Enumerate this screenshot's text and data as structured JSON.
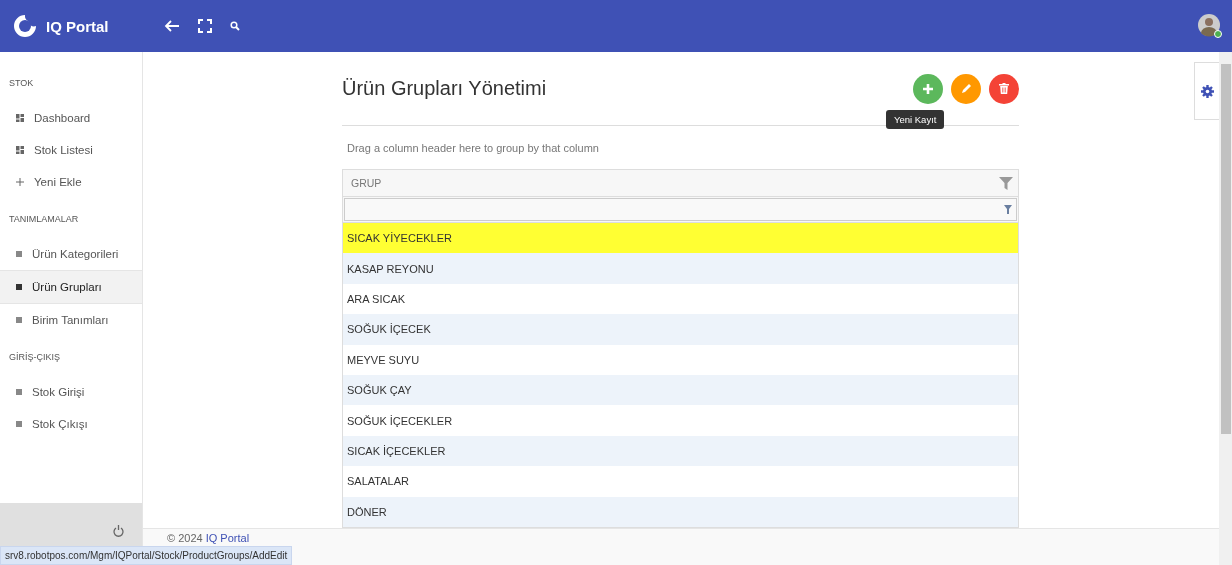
{
  "header": {
    "app_name": "IQ Portal"
  },
  "sidebar": {
    "sections": [
      {
        "title": "STOK",
        "items": [
          {
            "label": "Dashboard",
            "kind": "grid",
            "selected": false
          },
          {
            "label": "Stok Listesi",
            "kind": "grid",
            "selected": false
          },
          {
            "label": "Yeni Ekle",
            "kind": "plus",
            "selected": false
          }
        ]
      },
      {
        "title": "TANIMLAMALAR",
        "items": [
          {
            "label": "Ürün Kategorileri",
            "kind": "square",
            "selected": false
          },
          {
            "label": "Ürün Grupları",
            "kind": "square",
            "selected": true
          },
          {
            "label": "Birim Tanımları",
            "kind": "square",
            "selected": false
          }
        ]
      },
      {
        "title": "GİRİŞ-ÇIKIŞ",
        "items": [
          {
            "label": "Stok Girişi",
            "kind": "square",
            "selected": false
          },
          {
            "label": "Stok Çıkışı",
            "kind": "square",
            "selected": false
          }
        ]
      }
    ]
  },
  "page": {
    "title": "Ürün Grupları Yönetimi",
    "actions": [
      {
        "kind": "add"
      },
      {
        "kind": "edit"
      },
      {
        "kind": "delete"
      }
    ],
    "tooltip": "Yeni Kayıt",
    "group_panel": "Drag a column header here to group by that column",
    "grid": {
      "columns": [
        {
          "label": "GRUP"
        }
      ],
      "rows": [
        {
          "grup": "SICAK YİYECEKLER",
          "selected": true
        },
        {
          "grup": "KASAP REYONU",
          "selected": false
        },
        {
          "grup": "ARA SICAK",
          "selected": false
        },
        {
          "grup": "SOĞUK İÇECEK",
          "selected": false
        },
        {
          "grup": "MEYVE SUYU",
          "selected": false
        },
        {
          "grup": "SOĞUK ÇAY",
          "selected": false
        },
        {
          "grup": "SOĞUK İÇECEKLER",
          "selected": false
        },
        {
          "grup": "SICAK İÇECEKLER",
          "selected": false
        },
        {
          "grup": "SALATALAR",
          "selected": false
        },
        {
          "grup": "DÖNER",
          "selected": false
        }
      ]
    }
  },
  "footer": {
    "copyright": "© 2024",
    "link": "IQ Portal"
  },
  "status_url": "srv8.robotpos.com/Mgm/IQPortal/Stock/ProductGroups/AddEdit"
}
